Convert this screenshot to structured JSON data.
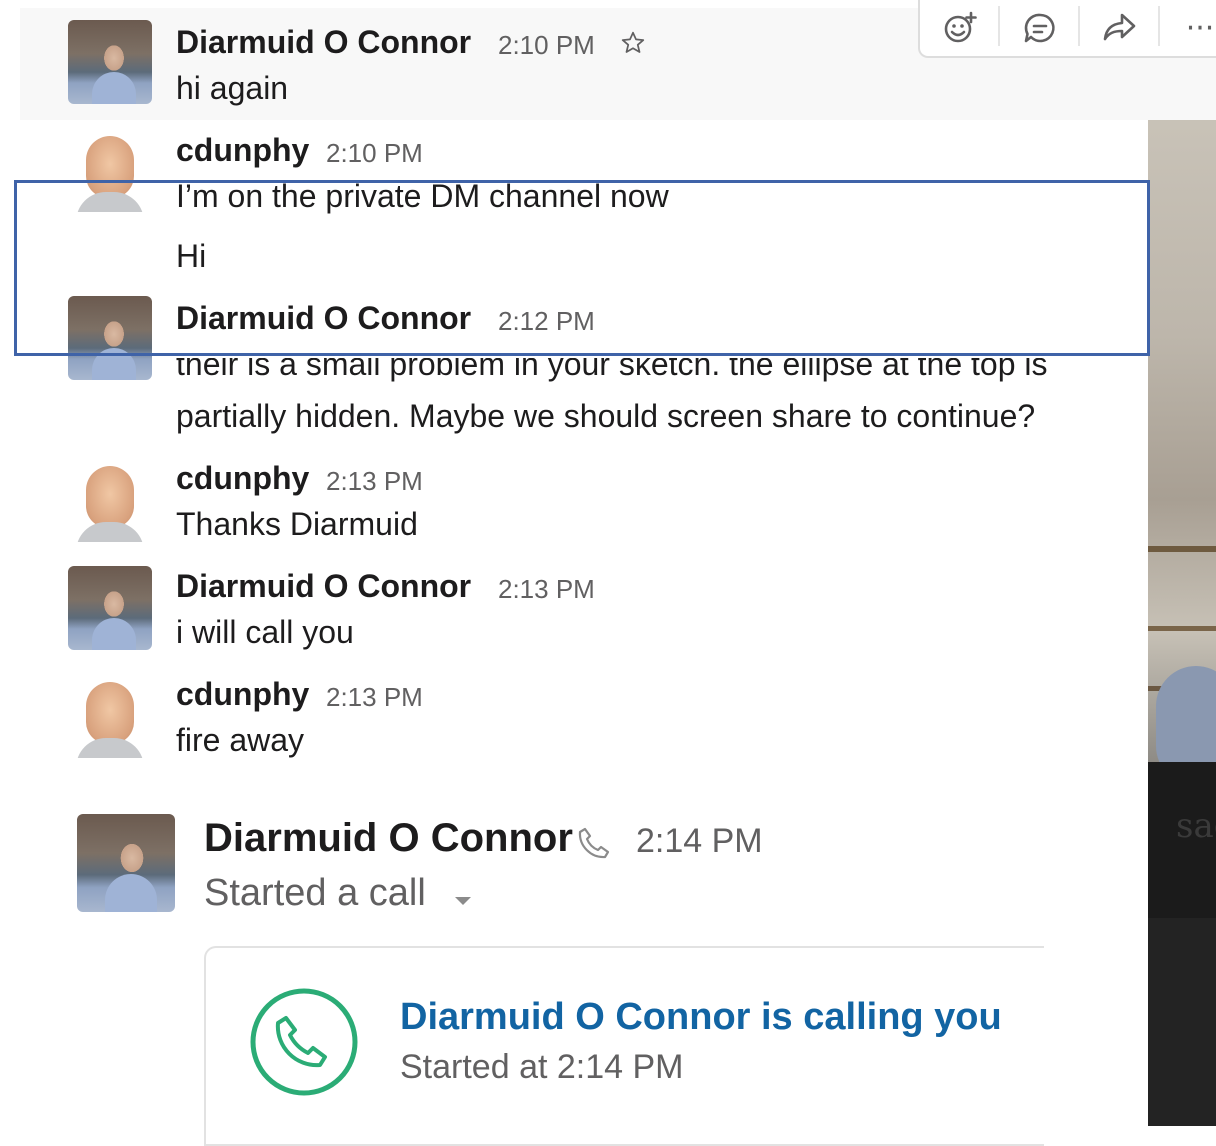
{
  "toolbar": {
    "add_reaction_icon": "add-reaction-icon",
    "reply_icon": "reply-in-thread-icon",
    "share_icon": "share-icon",
    "more_label": "···"
  },
  "messages": [
    {
      "author": "Diarmuid O Connor",
      "time": "2:10 PM",
      "avatar": "diarmuid",
      "lines": [
        "hi again"
      ],
      "starred_icon": "star-outline-icon"
    },
    {
      "author": "cdunphy",
      "time": "2:10 PM",
      "avatar": "cdunphy",
      "lines": [
        "I’m on the private DM channel now",
        "Hi"
      ]
    },
    {
      "author": "Diarmuid O Connor",
      "time": "2:12 PM",
      "avatar": "diarmuid",
      "lines": [
        "their is a small problem in your sketch. the ellipse at the top is",
        "partially hidden. Maybe we should screen share to continue?"
      ]
    },
    {
      "author": "cdunphy",
      "time": "2:13 PM",
      "avatar": "cdunphy",
      "lines": [
        "Thanks Diarmuid"
      ]
    },
    {
      "author": "Diarmuid O Connor",
      "time": "2:13 PM",
      "avatar": "diarmuid",
      "lines": [
        "i will call you"
      ]
    },
    {
      "author": "cdunphy",
      "time": "2:13 PM",
      "avatar": "cdunphy",
      "lines": [
        "fire away"
      ]
    }
  ],
  "call": {
    "author": "Diarmuid O Connor",
    "time": "2:14 PM",
    "subtitle": "Started a call",
    "card_title": "Diarmuid O Connor is calling you",
    "card_subtitle": "Started at 2:14 PM"
  },
  "video_panel": {
    "partial_text": "sag"
  },
  "colors": {
    "link_blue": "#1264a3",
    "call_green": "#2bac76",
    "highlight_border": "#3f63a8",
    "muted": "#616061"
  }
}
